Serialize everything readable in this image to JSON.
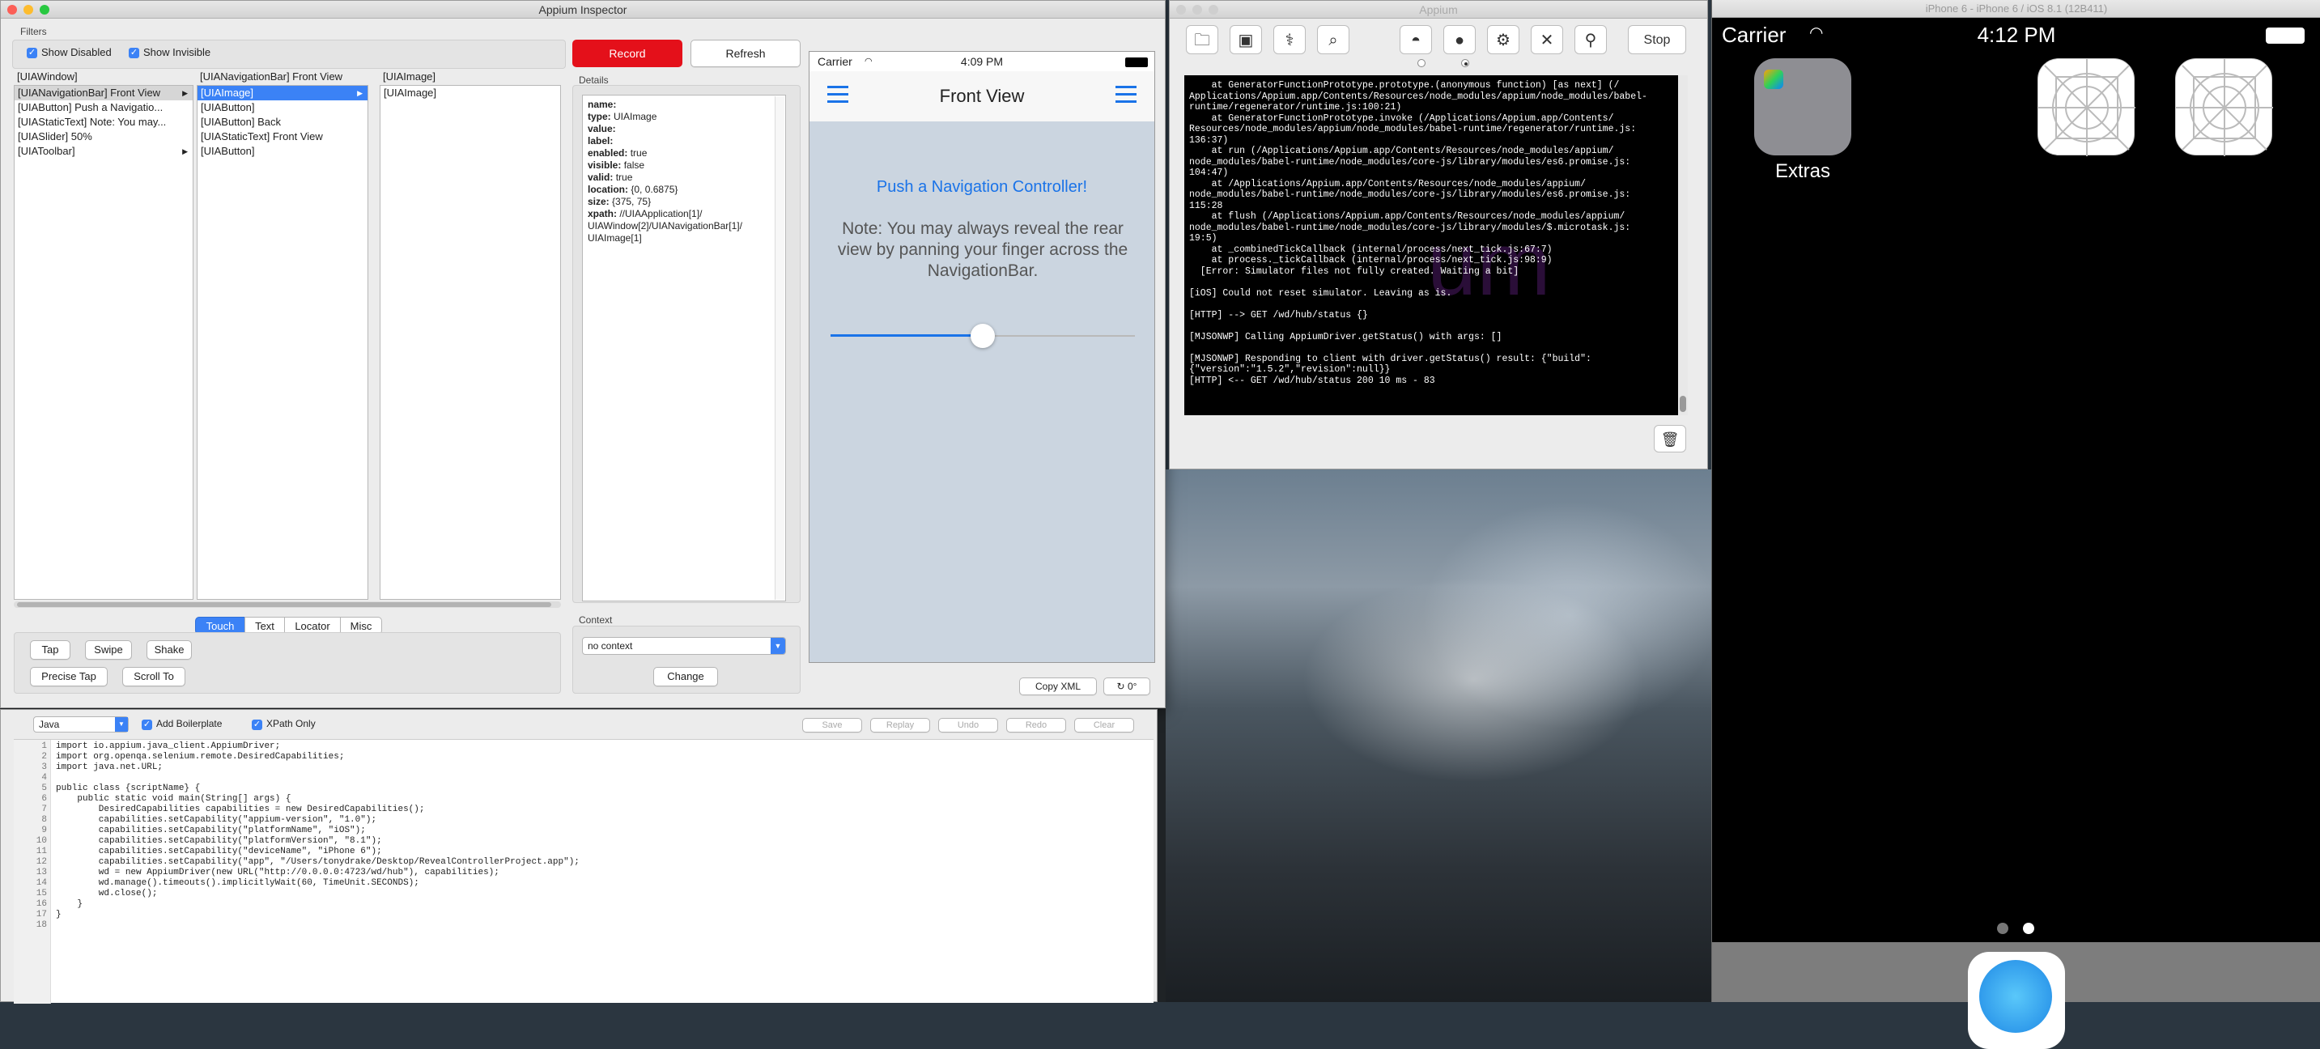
{
  "inspector": {
    "title": "Appium Inspector",
    "filters_label": "Filters",
    "show_disabled": "Show Disabled",
    "show_invisible": "Show Invisible",
    "record": "Record",
    "refresh": "Refresh",
    "col1_header": "[UIAWindow]",
    "col1_items": [
      "[UIANavigationBar] Front View",
      "[UIAButton] Push a Navigatio...",
      "[UIAStaticText] Note: You may...",
      "[UIASlider] 50%",
      "[UIAToolbar]"
    ],
    "col2_header": "[UIANavigationBar] Front View",
    "col2_items": [
      "[UIAImage]",
      "[UIAButton]",
      "[UIAButton] Back",
      "[UIAStaticText] Front View",
      "[UIAButton]"
    ],
    "col3_header": "[UIAImage]",
    "col3_items": [
      "[UIAImage]"
    ],
    "details_label": "Details",
    "details": [
      {
        "k": "name:",
        "v": ""
      },
      {
        "k": "type:",
        "v": "UIAImage"
      },
      {
        "k": "value:",
        "v": ""
      },
      {
        "k": "label:",
        "v": ""
      },
      {
        "k": "enabled:",
        "v": "true"
      },
      {
        "k": "visible:",
        "v": "false"
      },
      {
        "k": "valid:",
        "v": "true"
      },
      {
        "k": "location:",
        "v": "{0, 0.6875}"
      },
      {
        "k": "size:",
        "v": "{375, 75}"
      },
      {
        "k": "xpath:",
        "v": "//UIAApplication[1]/"
      }
    ],
    "xpath_cont1": "UIAWindow[2]/UIANavigationBar[1]/",
    "xpath_cont2": "UIAImage[1]",
    "tabs": [
      "Touch",
      "Text",
      "Locator",
      "Misc"
    ],
    "touch_buttons": [
      "Tap",
      "Swipe",
      "Shake",
      "Precise Tap",
      "Scroll To"
    ],
    "context_label": "Context",
    "context_value": "no context",
    "change": "Change",
    "copy_xml": "Copy XML",
    "rotate": "0°",
    "preview": {
      "carrier": "Carrier",
      "time": "4:09 PM",
      "nav_title": "Front View",
      "push_link": "Push a Navigation Controller!",
      "note": "Note: You may always reveal the rear view by panning your finger across the NavigationBar.",
      "slider_value": 0.5
    }
  },
  "code": {
    "language": "Java",
    "add_boilerplate": "Add Boilerplate",
    "xpath_only": "XPath Only",
    "actions": [
      "Save",
      "Replay",
      "Undo",
      "Redo",
      "Clear"
    ],
    "lines": [
      "import io.appium.java_client.AppiumDriver;",
      "import org.openqa.selenium.remote.DesiredCapabilities;",
      "import java.net.URL;",
      "",
      "public class {scriptName} {",
      "    public static void main(String[] args) {",
      "        DesiredCapabilities capabilities = new DesiredCapabilities();",
      "        capabilities.setCapability(\"appium-version\", \"1.0\");",
      "        capabilities.setCapability(\"platformName\", \"iOS\");",
      "        capabilities.setCapability(\"platformVersion\", \"8.1\");",
      "        capabilities.setCapability(\"deviceName\", \"iPhone 6\");",
      "        capabilities.setCapability(\"app\", \"/Users/tonydrake/Desktop/RevealControllerProject.app\");",
      "        wd = new AppiumDriver(new URL(\"http://0.0.0.0:4723/wd/hub\"), capabilities);",
      "        wd.manage().timeouts().implicitlyWait(60, TimeUnit.SECONDS);",
      "        wd.close();",
      "    }",
      "}",
      ""
    ]
  },
  "appium": {
    "title": "Appium",
    "stop": "Stop",
    "console_lines": [
      "    at GeneratorFunctionPrototype.prototype.(anonymous function) [as next] (/",
      "Applications/Appium.app/Contents/Resources/node_modules/appium/node_modules/babel-",
      "runtime/regenerator/runtime.js:100:21)",
      "    at GeneratorFunctionPrototype.invoke (/Applications/Appium.app/Contents/",
      "Resources/node_modules/appium/node_modules/babel-runtime/regenerator/runtime.js:",
      "136:37)",
      "    at run (/Applications/Appium.app/Contents/Resources/node_modules/appium/",
      "node_modules/babel-runtime/node_modules/core-js/library/modules/es6.promise.js:",
      "104:47)",
      "    at /Applications/Appium.app/Contents/Resources/node_modules/appium/",
      "node_modules/babel-runtime/node_modules/core-js/library/modules/es6.promise.js:",
      "115:28",
      "    at flush (/Applications/Appium.app/Contents/Resources/node_modules/appium/",
      "node_modules/babel-runtime/node_modules/core-js/library/modules/$.microtask.js:",
      "19:5)",
      "    at _combinedTickCallback (internal/process/next_tick.js:67:7)",
      "    at process._tickCallback (internal/process/next_tick.js:98:9)",
      "  [Error: Simulator files not fully created. Waiting a bit]",
      "",
      "[iOS] Could not reset simulator. Leaving as is.",
      "",
      "[HTTP] --> GET /wd/hub/status {}",
      "",
      "[MJSONWP] Calling AppiumDriver.getStatus() with args: []",
      "",
      "[MJSONWP] Responding to client with driver.getStatus() result: {\"build\":",
      "{\"version\":\"1.5.2\",\"revision\":null}}",
      "[HTTP] <-- GET /wd/hub/status 200 10 ms - 83"
    ]
  },
  "simulator": {
    "title": "iPhone 6 - iPhone 6 / iOS 8.1 (12B411)",
    "carrier": "Carrier",
    "time": "4:12 PM",
    "folder_label": "Extras"
  }
}
